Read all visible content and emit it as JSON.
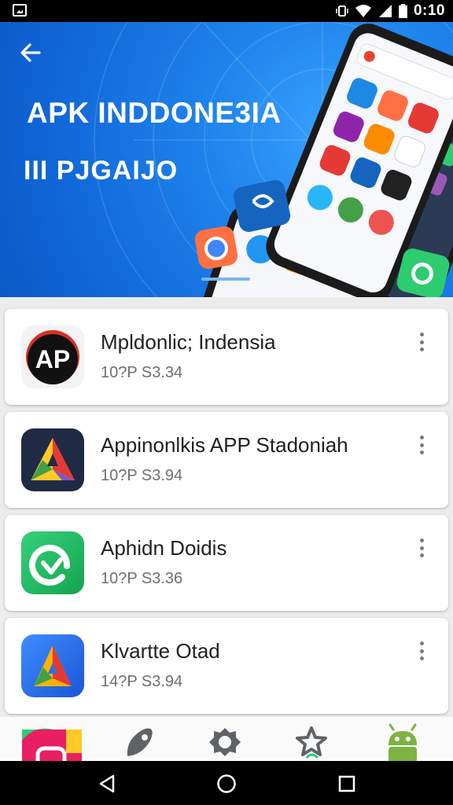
{
  "status_bar": {
    "time": "0:10",
    "icons": [
      "image-icon",
      "vibrate-icon",
      "wifi-icon",
      "signal-icon",
      "battery-icon"
    ]
  },
  "header": {
    "back_icon": "arrow-left-icon",
    "title": "APK INDDONE3IA",
    "subtitle": "III PJGAIJO"
  },
  "apps": [
    {
      "name": "Mpldonlic; Indensia",
      "meta": "10?P  S3.34",
      "icon": "ap-logo-icon"
    },
    {
      "name": "Appinonlkis APP Stadoniah",
      "meta": "10?P  S3.94",
      "icon": "triangle-a-logo-icon"
    },
    {
      "name": "Aphidn Doidis",
      "meta": "10?P  S3.36",
      "icon": "green-q-logo-icon"
    },
    {
      "name": "Klvartte Otad",
      "meta": "14?P  S3.94",
      "icon": "blue-a-logo-icon"
    }
  ],
  "bottom_tabs": [
    "instagram-like-icon",
    "rocket-icon",
    "gear-badge-icon",
    "star-icon",
    "android-icon"
  ],
  "nav_bar": [
    "back-triangle-icon",
    "home-circle-icon",
    "recents-square-icon"
  ],
  "colors": {
    "hero": "#1e83ec",
    "card_bg": "#ffffff",
    "list_bg": "#ececec",
    "text": "#202124",
    "meta": "#6f6f6f"
  }
}
